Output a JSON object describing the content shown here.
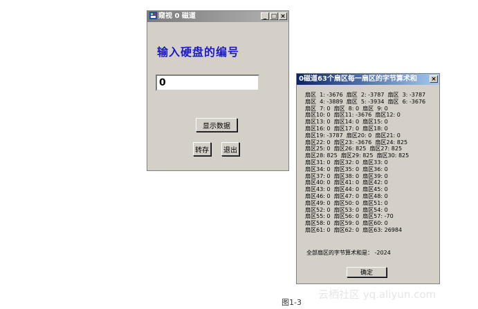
{
  "window_main": {
    "title": "窥视 0 磁道",
    "minimize": "_",
    "maximize": "□",
    "close": "×",
    "heading": "输入硬盘的编号",
    "disk_input_value": "0",
    "show_data_button": "显示数据",
    "save_button": "转存",
    "exit_button": "退出"
  },
  "window_result": {
    "title": "0磁道63个扇区每一扇区的字节算术和",
    "close": "×",
    "lines": [
      "扇区  1: -3676  扇区  2: -3787  扇区  3: -3787",
      "扇区  4: -3889  扇区  5: -3934  扇区  6: -3676",
      "扇区  7: 0  扇区  8: 0  扇区  9: 0",
      "扇区10: 0  扇区11: -3676  扇区12: 0",
      "扇区13: 0  扇区14: 0  扇区15: 0",
      "扇区16: 0  扇区17: 0  扇区18: 0",
      "扇区19: -3787  扇区20: 0  扇区21: 0",
      "扇区22: 0  扇区23: -3676  扇区24: 825",
      "扇区25: 0  扇区26: 825  扇区27: 825",
      "扇区28: 825  扇区29: 825  扇区30: 825",
      "扇区31: 0  扇区32: 0  扇区33: 0",
      "扇区34: 0  扇区35: 0  扇区36: 0",
      "扇区37: 0  扇区38: 0  扇区39: 0",
      "扇区40: 0  扇区41: 0  扇区42: 0",
      "扇区43: 0  扇区44: 0  扇区45: 0",
      "扇区46: 0  扇区47: 0  扇区48: 0",
      "扇区49: 0  扇区50: 0  扇区51: 0",
      "扇区52: 0  扇区53: 0  扇区54: 0",
      "扇区55: 0  扇区56: 0  扇区57: -70",
      "扇区58: 0  扇区59: 0  扇区60: 0",
      "扇区61: 0  扇区62: 0  扇区63: 26984"
    ],
    "total_text": "全部扇区的字节算术和是： -2024",
    "ok_button": "确定"
  },
  "caption": "图1-3",
  "watermark": "云栖社区 yq.aliyun.com",
  "icon": "disk-app-icon"
}
